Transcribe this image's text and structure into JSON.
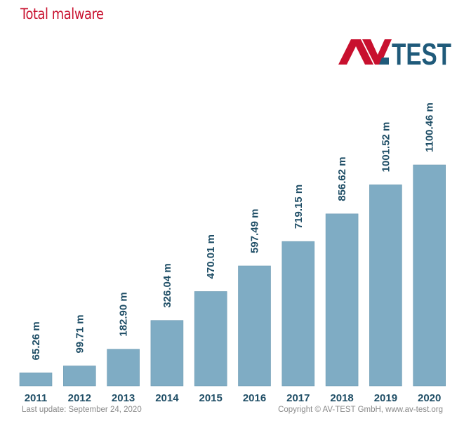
{
  "header": {
    "title": "Total malware",
    "logo_text_left": "AV",
    "logo_text_right": "TEST",
    "logo_colors": {
      "red": "#c8102e",
      "blue": "#1f5a7a"
    }
  },
  "footer": {
    "last_update": "Last update: September 24, 2020",
    "copyright": "Copyright © AV-TEST GmbH, www.av-test.org"
  },
  "colors": {
    "bar": "#7facc4",
    "label": "#1f4e66",
    "title": "#c8102e",
    "footer": "#8a8a8a"
  },
  "chart_data": {
    "type": "bar",
    "title": "Total malware",
    "xlabel": "",
    "ylabel": "",
    "unit": "m",
    "categories": [
      "2011",
      "2012",
      "2013",
      "2014",
      "2015",
      "2016",
      "2017",
      "2018",
      "2019",
      "2020"
    ],
    "values": [
      65.26,
      99.71,
      182.9,
      326.04,
      470.01,
      597.49,
      719.15,
      856.62,
      1001.52,
      1100.46
    ],
    "data_labels": [
      "65.26 m",
      "99.71 m",
      "182.90 m",
      "326.04 m",
      "470.01 m",
      "597.49 m",
      "719.15 m",
      "856.62 m",
      "1001.52 m",
      "1100.46 m"
    ],
    "ylim": [
      0,
      1100.46
    ],
    "grid": false,
    "legend": "none"
  }
}
